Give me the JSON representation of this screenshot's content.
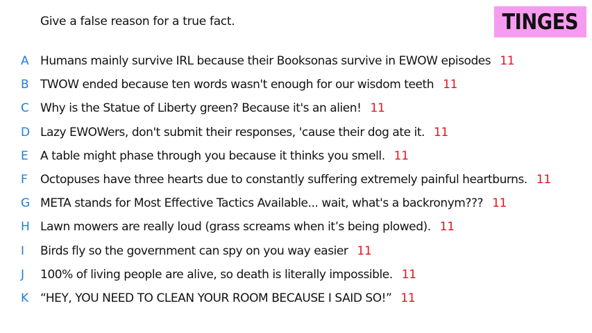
{
  "prompt": "Give a false reason for a true fact.",
  "tag": "TINGES",
  "colors": {
    "tag_background": "#f69cf0",
    "letter": "#1e7fd8",
    "score": "#e0141e",
    "text": "#111111"
  },
  "responses": [
    {
      "letter": "A",
      "text": "Humans mainly survive IRL because their Booksonas survive in EWOW episodes",
      "score": "11"
    },
    {
      "letter": "B",
      "text": "TWOW ended because ten words wasn't enough for our wisdom teeth",
      "score": "11"
    },
    {
      "letter": "C",
      "text": "Why is the Statue of Liberty green? Because it's an alien!",
      "score": "11"
    },
    {
      "letter": "D",
      "text": "Lazy EWOWers, don't submit their responses, 'cause their dog ate it.",
      "score": "11"
    },
    {
      "letter": "E",
      "text": "A table might phase through you because it thinks you smell.",
      "score": "11"
    },
    {
      "letter": "F",
      "text": "Octopuses have three hearts due to constantly suffering extremely painful heartburns.",
      "score": "11"
    },
    {
      "letter": "G",
      "text": "META stands for Most Effective Tactics Available... wait, what's a backronym???",
      "score": "11"
    },
    {
      "letter": "H",
      "text": "Lawn mowers are really loud (grass screams when it’s being plowed).",
      "score": "11"
    },
    {
      "letter": "I",
      "text": "Birds fly so the government can spy on you way easier",
      "score": "11"
    },
    {
      "letter": "J",
      "text": "100% of living people are alive, so death is literally impossible.",
      "score": "11"
    },
    {
      "letter": "K",
      "text": "“HEY, YOU NEED TO CLEAN YOUR ROOM BECAUSE I SAID SO!”",
      "score": "11"
    }
  ]
}
